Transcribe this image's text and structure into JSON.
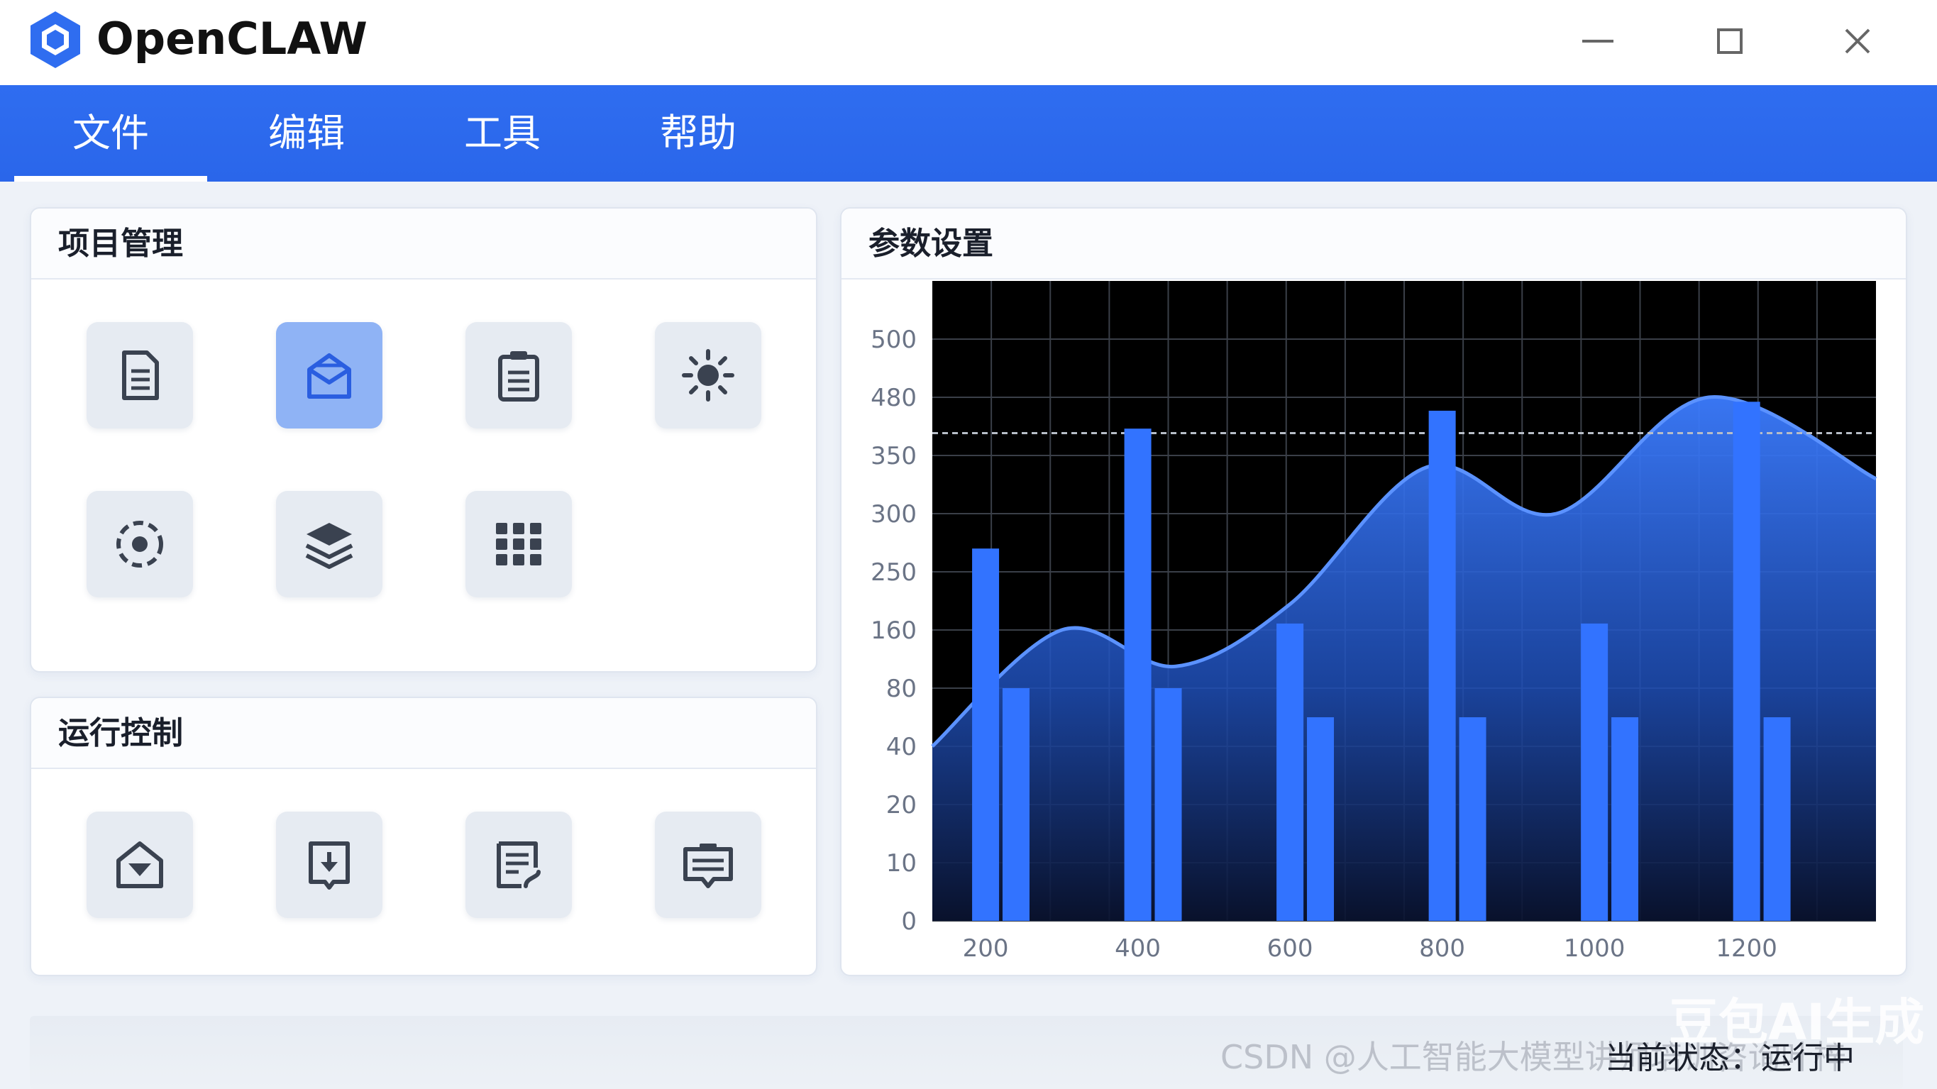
{
  "app": {
    "title": "OpenCLAW",
    "brand_color": "#2f6df0"
  },
  "window_controls": {
    "minimize_icon": "minimize-icon",
    "maximize_icon": "maximize-icon",
    "close_icon": "close-icon"
  },
  "menu": {
    "items": [
      {
        "label": "文件",
        "active": true
      },
      {
        "label": "编辑",
        "active": false
      },
      {
        "label": "工具",
        "active": false
      },
      {
        "label": "帮助",
        "active": false
      }
    ]
  },
  "project_panel": {
    "title": "项目管理",
    "tiles": [
      {
        "icon": "document-icon",
        "selected": false
      },
      {
        "icon": "package-icon",
        "selected": true
      },
      {
        "icon": "clipboard-icon",
        "selected": false
      },
      {
        "icon": "sun-icon",
        "selected": false
      },
      {
        "icon": "target-icon",
        "selected": false
      },
      {
        "icon": "layers-icon",
        "selected": false
      },
      {
        "icon": "grid-icon",
        "selected": false
      }
    ]
  },
  "run_panel": {
    "title": "运行控制",
    "tiles": [
      {
        "icon": "home-download-icon"
      },
      {
        "icon": "import-icon"
      },
      {
        "icon": "edit-document-icon"
      },
      {
        "icon": "message-icon"
      }
    ]
  },
  "param_panel": {
    "title": "参数设置"
  },
  "chart_data": {
    "type": "bar",
    "y_ticks": [
      "500",
      "480",
      "350",
      "300",
      "250",
      "160",
      "80",
      "40",
      "20",
      "10",
      "0"
    ],
    "x_ticks": [
      "200",
      "400",
      "600",
      "800",
      "1000",
      "1200"
    ],
    "x_range": [
      130,
      1370
    ],
    "reference_line": {
      "value": "≈400",
      "style": "dashed"
    },
    "bar_series": [
      {
        "values": [
          {
            "x": 200,
            "y": "≈270"
          },
          {
            "x": 240,
            "y": "≈80"
          },
          {
            "x": 400,
            "y": "≈410"
          },
          {
            "x": 440,
            "y": "≈80"
          },
          {
            "x": 600,
            "y": "≈170"
          },
          {
            "x": 640,
            "y": "≈60"
          },
          {
            "x": 800,
            "y": "≈450"
          },
          {
            "x": 840,
            "y": "≈60"
          },
          {
            "x": 1000,
            "y": "≈170"
          },
          {
            "x": 1040,
            "y": "≈60"
          },
          {
            "x": 1200,
            "y": "≈470"
          },
          {
            "x": 1240,
            "y": "≈60"
          }
        ]
      }
    ],
    "area_series": [
      {
        "values": [
          {
            "x": 130,
            "y": 40
          },
          {
            "x": 300,
            "y": 160
          },
          {
            "x": 450,
            "y": 110
          },
          {
            "x": 600,
            "y": 200
          },
          {
            "x": 780,
            "y": 340
          },
          {
            "x": 950,
            "y": 300
          },
          {
            "x": 1150,
            "y": 480
          },
          {
            "x": 1370,
            "y": 330
          }
        ]
      }
    ],
    "grid": true,
    "background": "#000000",
    "bar_color": "#3273ff",
    "area_color": "#2f6df0"
  },
  "status": {
    "text": "当前状态：运行中"
  },
  "watermarks": {
    "top": "豆包AI生成",
    "bottom": "CSDN @人工智能大模型讲师培训咨询叶梓"
  }
}
